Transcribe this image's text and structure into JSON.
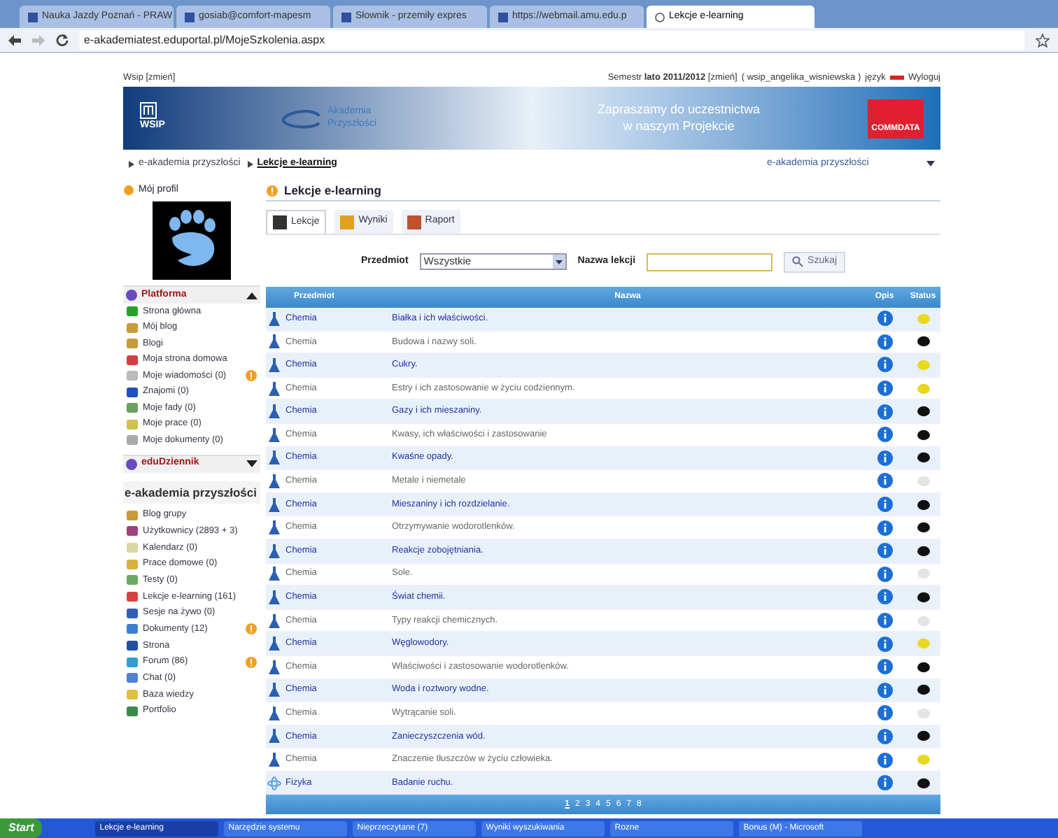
{
  "browser": {
    "tabs": [
      {
        "label": "Nauka Jazdy Poznań - PRAW",
        "selected": false
      },
      {
        "label": "gosiab@comfort-mapesm",
        "selected": false
      },
      {
        "label": "Słownik - przemiły expres",
        "selected": false
      },
      {
        "label": "https://webmail.amu.edu.p",
        "selected": false
      },
      {
        "label": "Lekcje e-learning",
        "selected": true
      }
    ],
    "address": "e-akademiatest.eduportal.pl/MojeSzkolenia.aspx"
  },
  "top_bar": {
    "left": "Wsip [zmień]",
    "semester": "Semestr **lato 2011/2012** [zmień]",
    "user": "( wsip_angelika_wisniewska )",
    "language": "język",
    "logout": "Wyloguj"
  },
  "banner": {
    "logo": "WSIP",
    "project": "Akademia Przyszłości",
    "invite_line_1": "Zapraszamy do uczestnictwa",
    "invite_line_2": "w naszym Projekcie",
    "partner": "COMMDATA"
  },
  "breadcrumb": [
    "e-akademia przyszłości",
    "Lekcje e-learning"
  ],
  "context_select": "e-akademia przyszłości",
  "sidebar": {
    "profile": "Mój profil",
    "sections": [
      {
        "title": "Platforma",
        "expanded": true,
        "items": [
          {
            "label": "Strona główna",
            "alert": false
          },
          {
            "label": "Mój blog",
            "alert": false
          },
          {
            "label": "Blogi",
            "alert": false
          },
          {
            "label": "Moja strona domowa",
            "alert": false
          },
          {
            "label": "Moje wiadomości (0)",
            "alert": true
          },
          {
            "label": "Znajomi (0)",
            "alert": false
          },
          {
            "label": "Moje fady (0)",
            "alert": false
          },
          {
            "label": "Moje prace (0)",
            "alert": false
          },
          {
            "label": "Moje dokumenty (0)",
            "alert": false
          }
        ]
      },
      {
        "title": "eduDziennik",
        "expanded": false
      }
    ],
    "group": {
      "title": "e-akademia przyszłości",
      "items": [
        {
          "label": "Blog grupy",
          "alert": false
        },
        {
          "label": "Użytkownicy (2893 + 3)",
          "alert": false
        },
        {
          "label": "Kalendarz (0)",
          "alert": false
        },
        {
          "label": "Prace domowe (0)",
          "alert": false
        },
        {
          "label": "Testy (0)",
          "alert": false
        },
        {
          "label": "Lekcje e-learning (161)",
          "alert": false
        },
        {
          "label": "Sesje na żywo (0)",
          "alert": false
        },
        {
          "label": "Dokumenty (12)",
          "alert": true
        },
        {
          "label": "Strona",
          "alert": false
        },
        {
          "label": "Forum (86)",
          "alert": true
        },
        {
          "label": "Chat (0)",
          "alert": false
        },
        {
          "label": "Baza wiedzy",
          "alert": false
        },
        {
          "label": "Portfolio",
          "alert": false
        }
      ]
    }
  },
  "main": {
    "title": "Lekcje e-learning",
    "tabs": [
      {
        "label": "Lekcje",
        "selected": true
      },
      {
        "label": "Wyniki",
        "selected": false
      },
      {
        "label": "Raport",
        "selected": false
      }
    ],
    "filter": {
      "subject_label": "Przedmiot",
      "subject_value": "Wszystkie",
      "name_label": "Nazwa lekcji",
      "search_button": "Szukaj"
    },
    "table": {
      "columns": [
        "Przedmiot",
        "Nazwa",
        "Opis",
        "Status"
      ],
      "rows": [
        {
          "kind": "flask",
          "subject": "Chemia",
          "name": "Białka i ich właściwości.",
          "color": "#e8d820"
        },
        {
          "kind": "flask",
          "subject": "Chemia",
          "name": "Budowa i nazwy soli.",
          "color": "#111111"
        },
        {
          "kind": "flask",
          "subject": "Chemia",
          "name": "Cukry.",
          "color": "#e8d820"
        },
        {
          "kind": "flask",
          "subject": "Chemia",
          "name": "Estry i ich zastosowanie w życiu codziennym.",
          "color": "#e8d820"
        },
        {
          "kind": "flask",
          "subject": "Chemia",
          "name": "Gazy i ich mieszaniny.",
          "color": "#111111"
        },
        {
          "kind": "flask",
          "subject": "Chemia",
          "name": "Kwasy, ich właściwości i zastosowanie",
          "color": "#111111"
        },
        {
          "kind": "flask",
          "subject": "Chemia",
          "name": "Kwaśne opady.",
          "color": "#111111"
        },
        {
          "kind": "flask",
          "subject": "Chemia",
          "name": "Metale i niemetale",
          "color": "#e4e4e4"
        },
        {
          "kind": "flask",
          "subject": "Chemia",
          "name": "Mieszaniny i ich rozdzielanie.",
          "color": "#111111"
        },
        {
          "kind": "flask",
          "subject": "Chemia",
          "name": "Otrzymywanie wodorotlenków.",
          "color": "#111111"
        },
        {
          "kind": "flask",
          "subject": "Chemia",
          "name": "Reakcje zobojętniania.",
          "color": "#111111"
        },
        {
          "kind": "flask",
          "subject": "Chemia",
          "name": "Sole.",
          "color": "#e4e4e4"
        },
        {
          "kind": "flask",
          "subject": "Chemia",
          "name": "Świat chemii.",
          "color": "#111111"
        },
        {
          "kind": "flask",
          "subject": "Chemia",
          "name": "Typy reakcji chemicznych.",
          "color": "#e4e4e4"
        },
        {
          "kind": "flask",
          "subject": "Chemia",
          "name": "Węglowodory.",
          "color": "#e8d820"
        },
        {
          "kind": "flask",
          "subject": "Chemia",
          "name": "Właściwości i zastosowanie wodorotlenków.",
          "color": "#111111"
        },
        {
          "kind": "flask",
          "subject": "Chemia",
          "name": "Woda i roztwory wodne.",
          "color": "#111111"
        },
        {
          "kind": "flask",
          "subject": "Chemia",
          "name": "Wytrącanie soli.",
          "color": "#e4e4e4"
        },
        {
          "kind": "flask",
          "subject": "Chemia",
          "name": "Zanieczyszczenia wód.",
          "color": "#111111"
        },
        {
          "kind": "flask",
          "subject": "Chemia",
          "name": "Znaczenie tłuszczów w życiu człowieka.",
          "color": "#e8d820"
        },
        {
          "kind": "atom",
          "subject": "Fizyka",
          "name": "Badanie ruchu.",
          "color": "#111111"
        }
      ]
    },
    "pagination": [
      {
        "label": "1",
        "selected": true
      },
      {
        "label": "2",
        "selected": false
      },
      {
        "label": "3",
        "selected": false
      },
      {
        "label": "4",
        "selected": false
      },
      {
        "label": "5",
        "selected": false
      },
      {
        "label": "6",
        "selected": false
      },
      {
        "label": "7",
        "selected": false
      },
      {
        "label": "8",
        "selected": false
      }
    ]
  },
  "taskbar": {
    "start": "Start",
    "windows": [
      {
        "label": "Lekcje e-learning",
        "selected": true
      },
      {
        "label": "Narzędzie systemu",
        "selected": false
      },
      {
        "label": "Nieprzeczytane (7)",
        "selected": false
      },
      {
        "label": "Wyniki wyszukiwania",
        "selected": false
      },
      {
        "label": "Rozne",
        "selected": false
      },
      {
        "label": "Bonus (M) - Microsoft",
        "selected": false
      }
    ]
  }
}
